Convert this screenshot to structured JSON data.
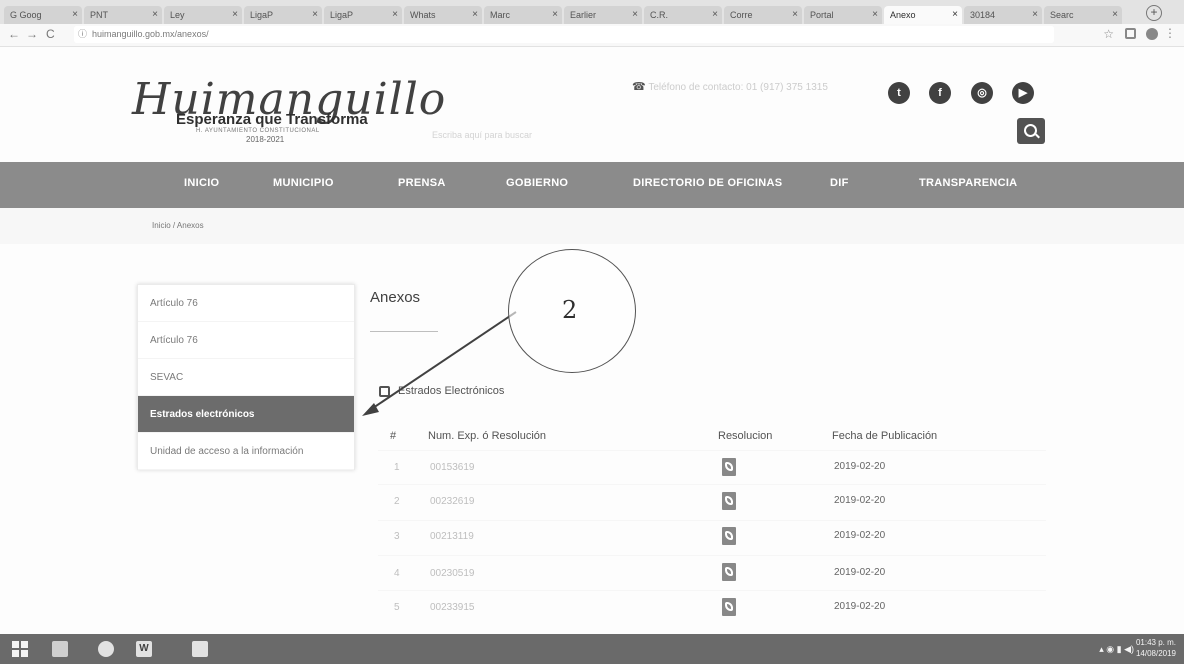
{
  "browser": {
    "tabs": [
      {
        "label": "G Goog"
      },
      {
        "label": "PNT"
      },
      {
        "label": "Ley"
      },
      {
        "label": "LigaP"
      },
      {
        "label": "LigaP"
      },
      {
        "label": "Whats"
      },
      {
        "label": "Marc"
      },
      {
        "label": "Earlier"
      },
      {
        "label": "C.R."
      },
      {
        "label": "Corre"
      },
      {
        "label": "Portal"
      },
      {
        "label": "Anexo"
      },
      {
        "label": "30184"
      },
      {
        "label": "Searc"
      }
    ],
    "url": "huimanguillo.gob.mx/anexos/"
  },
  "header": {
    "logo_script": "Huimanguillo",
    "tagline": "Esperanza que Transforma",
    "sub": "H. AYUNTAMIENTO CONSTITUCIONAL",
    "years": "2018-2021",
    "contact_text": "Teléfono de contacto: 01 (917) 375 1315",
    "social": [
      "twitter-icon",
      "facebook-icon",
      "instagram-icon",
      "youtube-icon"
    ],
    "search_placeholder": "Escriba aquí para buscar"
  },
  "nav": {
    "items": [
      "INICIO",
      "MUNICIPIO",
      "PRENSA",
      "GOBIERNO",
      "DIRECTORIO DE OFICINAS",
      "DIF",
      "TRANSPARENCIA"
    ]
  },
  "breadcrumb": "Inicio / Anexos",
  "sidebar": {
    "items": [
      {
        "label": "Artículo 76"
      },
      {
        "label": "Artículo 76"
      },
      {
        "label": "SEVAC"
      },
      {
        "label": "Estrados electrónicos"
      },
      {
        "label": "Unidad de acceso a la información"
      }
    ],
    "active_index": 3
  },
  "content": {
    "title": "Anexos",
    "section": "Estrados Electrónicos",
    "columns": [
      "#",
      "Num. Exp. ó Resolución",
      "Resolucion",
      "Fecha de Publicación"
    ],
    "rows": [
      {
        "n": "1",
        "exp": "00153619",
        "date": "2019-02-20"
      },
      {
        "n": "2",
        "exp": "00232619",
        "date": "2019-02-20"
      },
      {
        "n": "3",
        "exp": "00213119",
        "date": "2019-02-20"
      },
      {
        "n": "4",
        "exp": "00230519",
        "date": "2019-02-20"
      },
      {
        "n": "5",
        "exp": "00233915",
        "date": "2019-02-20"
      }
    ]
  },
  "annotation": {
    "number": "2"
  },
  "taskbar": {
    "time": "01:43 p. m.",
    "date": "14/08/2019"
  }
}
